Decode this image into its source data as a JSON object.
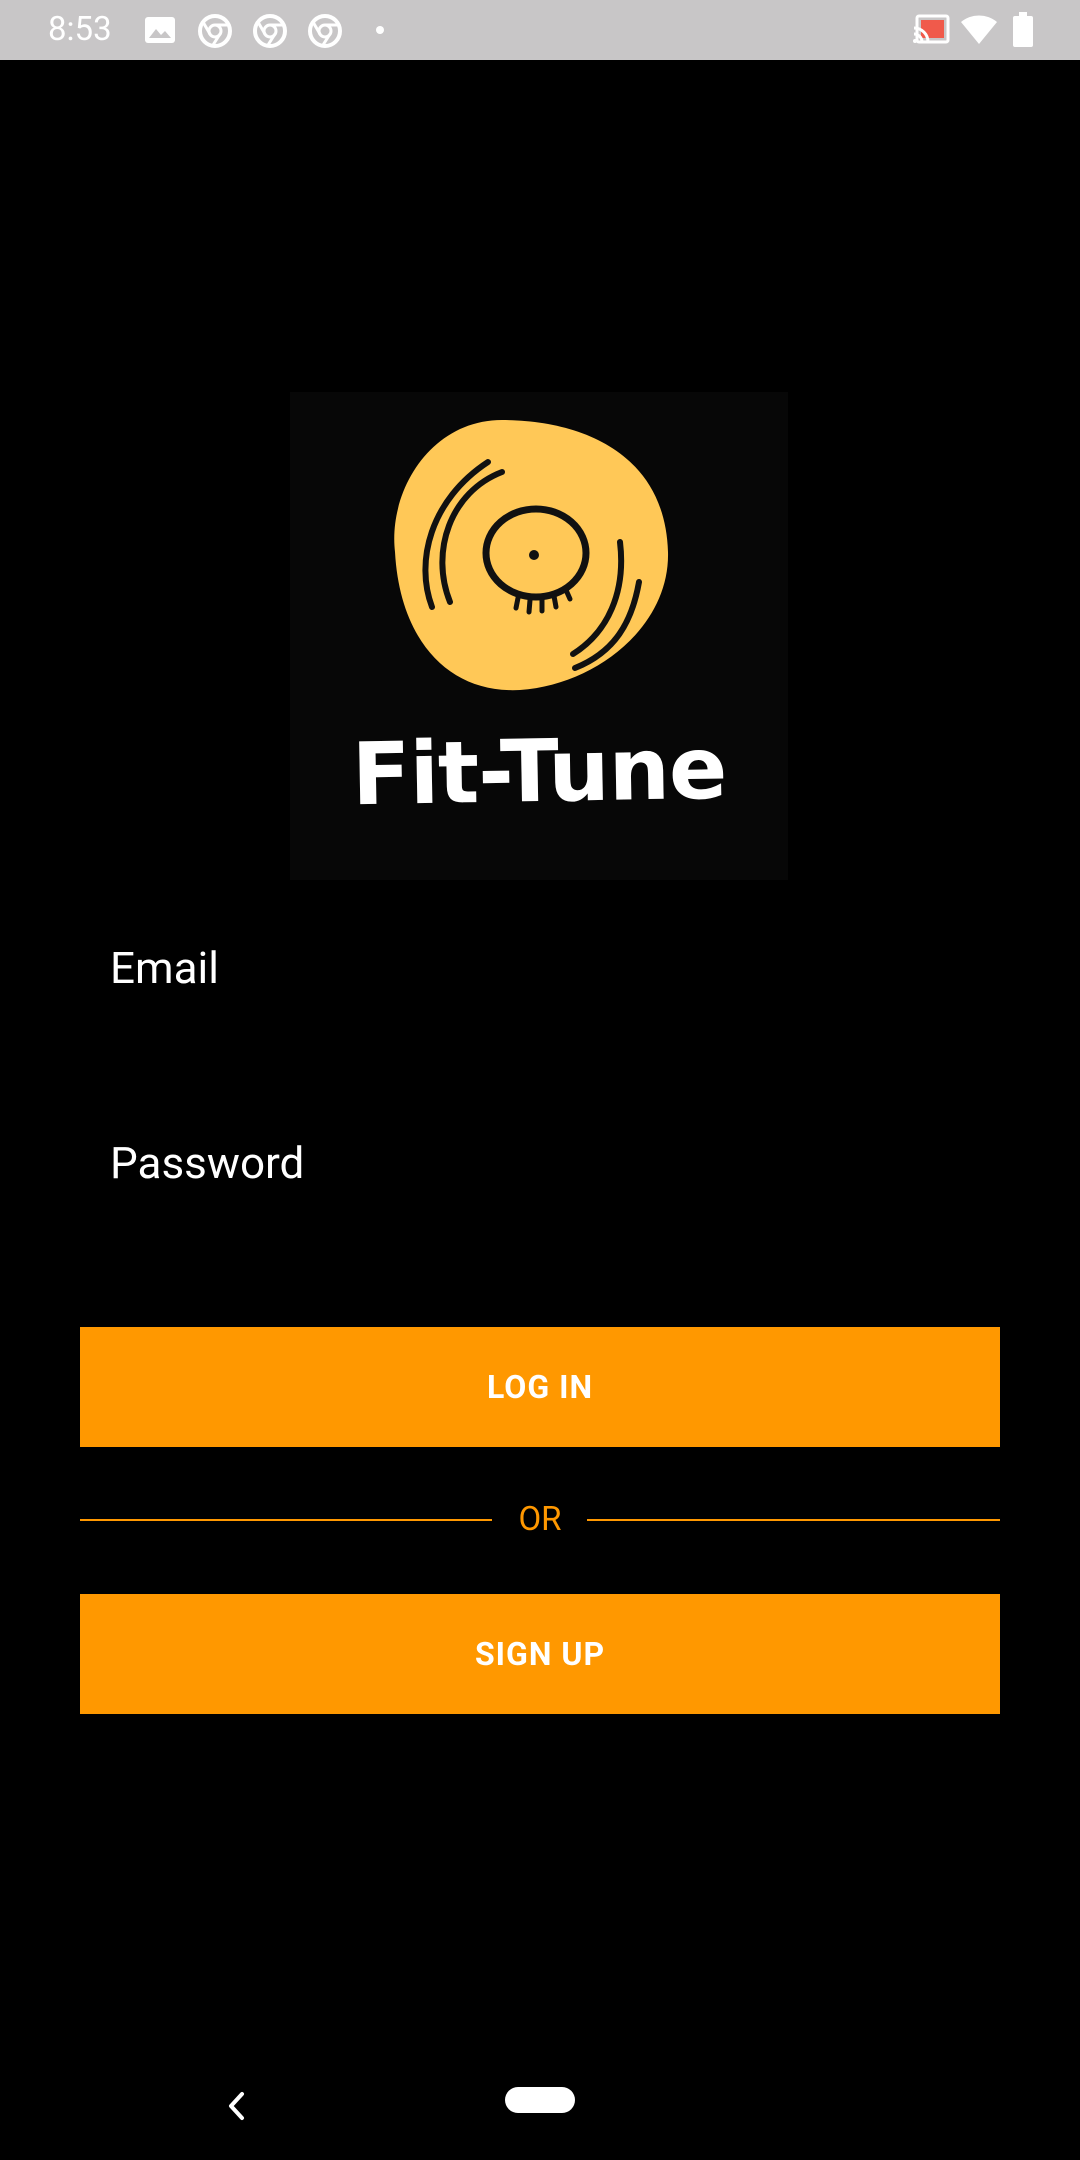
{
  "status_bar": {
    "time": "8:53",
    "left_icons": [
      "image-icon",
      "chrome-icon",
      "chrome-icon",
      "chrome-icon",
      "notification-dot-icon"
    ],
    "right_icons": [
      "cast-icon",
      "wifi-icon",
      "battery-icon"
    ]
  },
  "logo": {
    "brand_name": "Fit-Tune",
    "icon": "vinyl-record-icon",
    "accent_color": "#ffc857"
  },
  "form": {
    "email_placeholder": "Email",
    "password_placeholder": "Password"
  },
  "buttons": {
    "login_label": "LOG IN",
    "signup_label": "SIGN UP",
    "color": "#ff9800"
  },
  "divider": {
    "label": "OR"
  },
  "nav_bar": {
    "back_icon": "back-chevron-icon",
    "home_icon": "home-pill-icon"
  }
}
